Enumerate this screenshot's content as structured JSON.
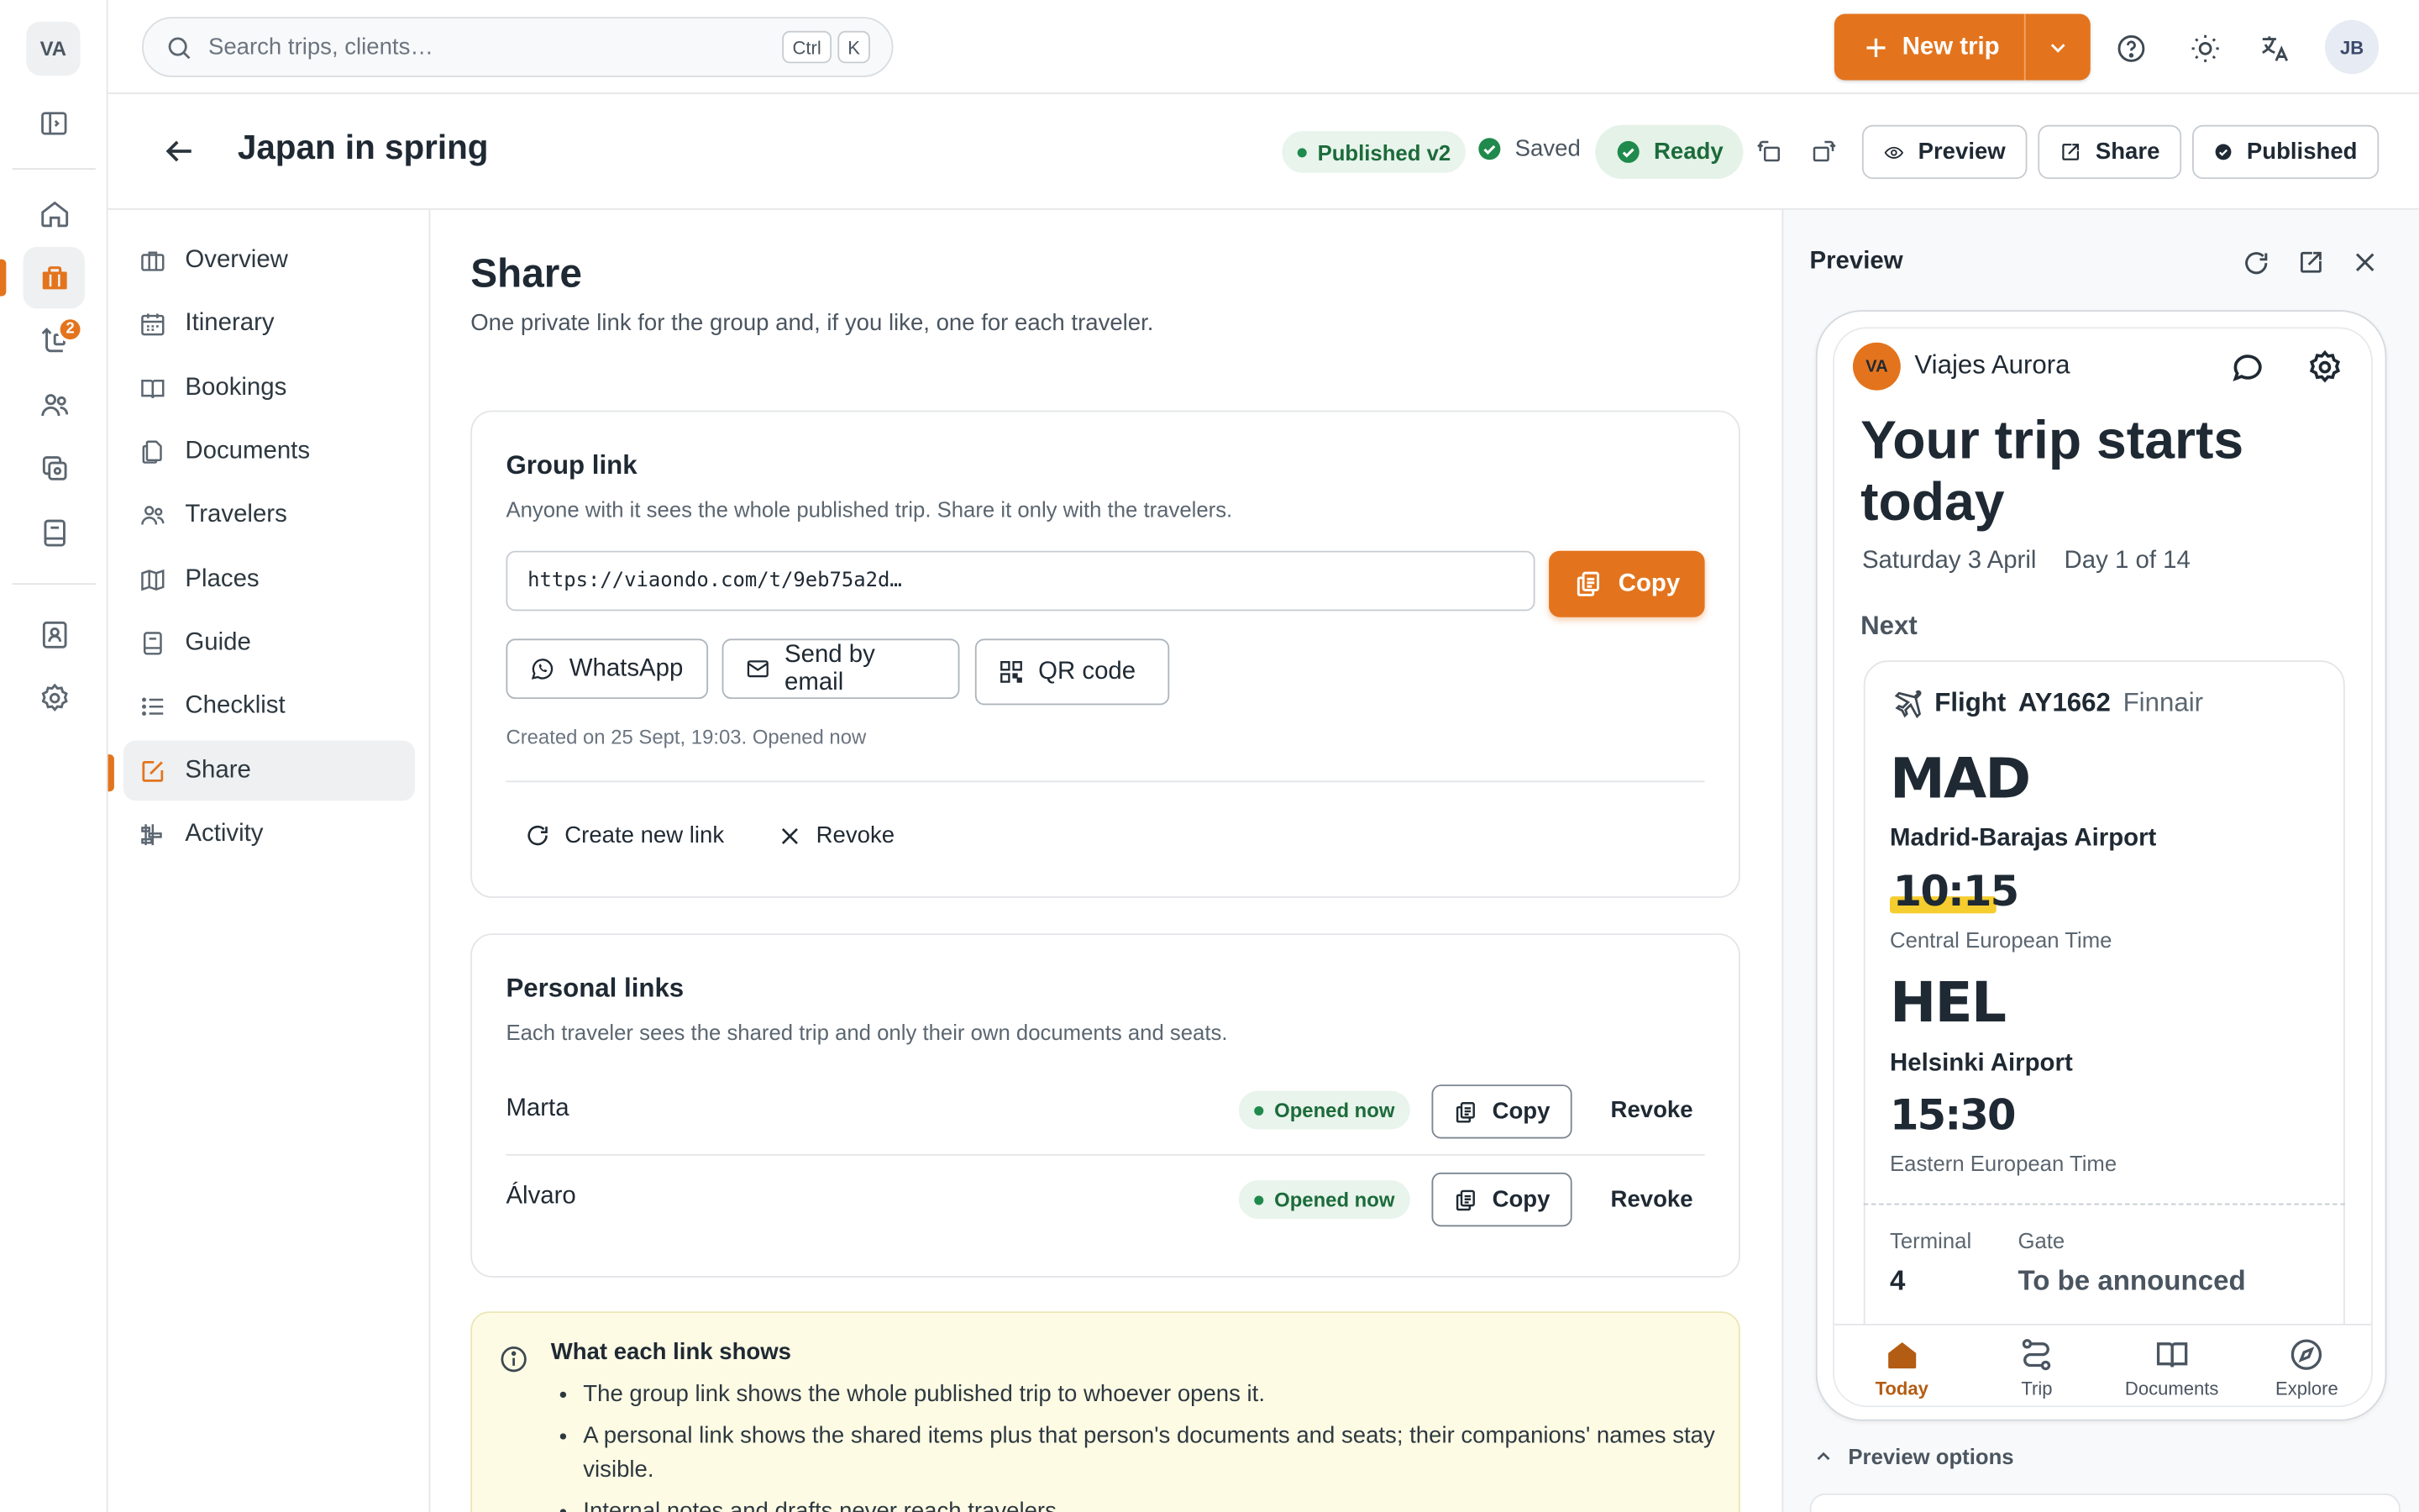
{
  "rail": {
    "logo": "VA",
    "badge": "2"
  },
  "topbar": {
    "search_placeholder": "Search trips, clients…",
    "kbd_ctrl": "Ctrl",
    "kbd_k": "K",
    "new_trip": "New trip",
    "user_initials": "JB"
  },
  "header": {
    "title": "Japan in spring",
    "published_version": "Published v2",
    "saved": "Saved",
    "ready": "Ready",
    "preview": "Preview",
    "share": "Share",
    "published": "Published"
  },
  "nav": {
    "items": [
      {
        "label": "Overview",
        "icon": "briefcase-icon"
      },
      {
        "label": "Itinerary",
        "icon": "calendar-icon"
      },
      {
        "label": "Bookings",
        "icon": "book-open-icon"
      },
      {
        "label": "Documents",
        "icon": "files-icon"
      },
      {
        "label": "Travelers",
        "icon": "users-icon"
      },
      {
        "label": "Places",
        "icon": "map-icon"
      },
      {
        "label": "Guide",
        "icon": "guide-book-icon"
      },
      {
        "label": "Checklist",
        "icon": "list-icon"
      },
      {
        "label": "Share",
        "icon": "share-edit-icon"
      },
      {
        "label": "Activity",
        "icon": "activity-icon"
      }
    ],
    "active": "Share"
  },
  "main": {
    "title": "Share",
    "subtitle": "One private link for the group and, if you like, one for each traveler.",
    "group": {
      "title": "Group link",
      "desc": "Anyone with it sees the whole published trip. Share it only with the travelers.",
      "url": "https://viaondo.com/t/9eb75a2d…",
      "copy": "Copy",
      "whatsapp": "WhatsApp",
      "email": "Send by email",
      "qr": "QR code",
      "meta": "Created on 25 Sept, 19:03. Opened now",
      "create_new": "Create new link",
      "revoke": "Revoke"
    },
    "personal": {
      "title": "Personal links",
      "desc": "Each traveler sees the shared trip and only their own documents and seats.",
      "rows": [
        {
          "name": "Marta",
          "status": "Opened now",
          "copy": "Copy",
          "revoke": "Revoke"
        },
        {
          "name": "Álvaro",
          "status": "Opened now",
          "copy": "Copy",
          "revoke": "Revoke"
        }
      ]
    },
    "info": {
      "title": "What each link shows",
      "items": [
        "The group link shows the whole published trip to whoever opens it.",
        "A personal link shows the shared items plus that person's documents and seats; their companions' names stay visible.",
        "Internal notes and drafts never reach travelers."
      ]
    }
  },
  "preview": {
    "title": "Preview",
    "agency_initials": "VA",
    "agency": "Viajes Aurora",
    "headline": "Your trip starts today",
    "date": "Saturday 3 April",
    "day": "Day 1 of 14",
    "next": "Next",
    "flight": {
      "label": "Flight",
      "number": "AY1662",
      "airline": "Finnair",
      "from_code": "MAD",
      "from_airport": "Madrid-Barajas Airport",
      "dep_time": "10:15",
      "dep_tz": "Central European Time",
      "to_code": "HEL",
      "to_airport": "Helsinki Airport",
      "arr_time": "15:30",
      "arr_tz": "Eastern European Time",
      "terminal_label": "Terminal",
      "terminal": "4",
      "gate_label": "Gate",
      "gate": "To be announced"
    },
    "tabs": [
      {
        "label": "Today",
        "icon": "home-icon"
      },
      {
        "label": "Trip",
        "icon": "route-icon"
      },
      {
        "label": "Documents",
        "icon": "book-icon"
      },
      {
        "label": "Explore",
        "icon": "compass-icon"
      }
    ],
    "options": "Preview options"
  },
  "colors": {
    "accent": "#e3741d",
    "success": "#1c6b3a",
    "info_bg": "#fdfbe4"
  }
}
